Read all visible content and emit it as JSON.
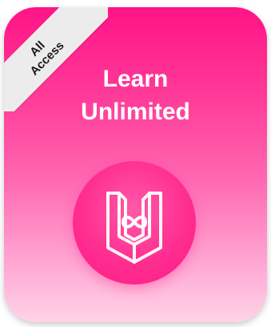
{
  "ribbon": {
    "label": "All\nAccess"
  },
  "card": {
    "title": "Learn\nUnlimited"
  },
  "icons": {
    "badge": "book-infinity-icon"
  },
  "colors": {
    "gradient_top": "#ff1486",
    "gradient_bottom": "#ffd3e8",
    "ribbon": "#ececec",
    "title_text": "#ffffff",
    "badge": "#ff2e90"
  }
}
